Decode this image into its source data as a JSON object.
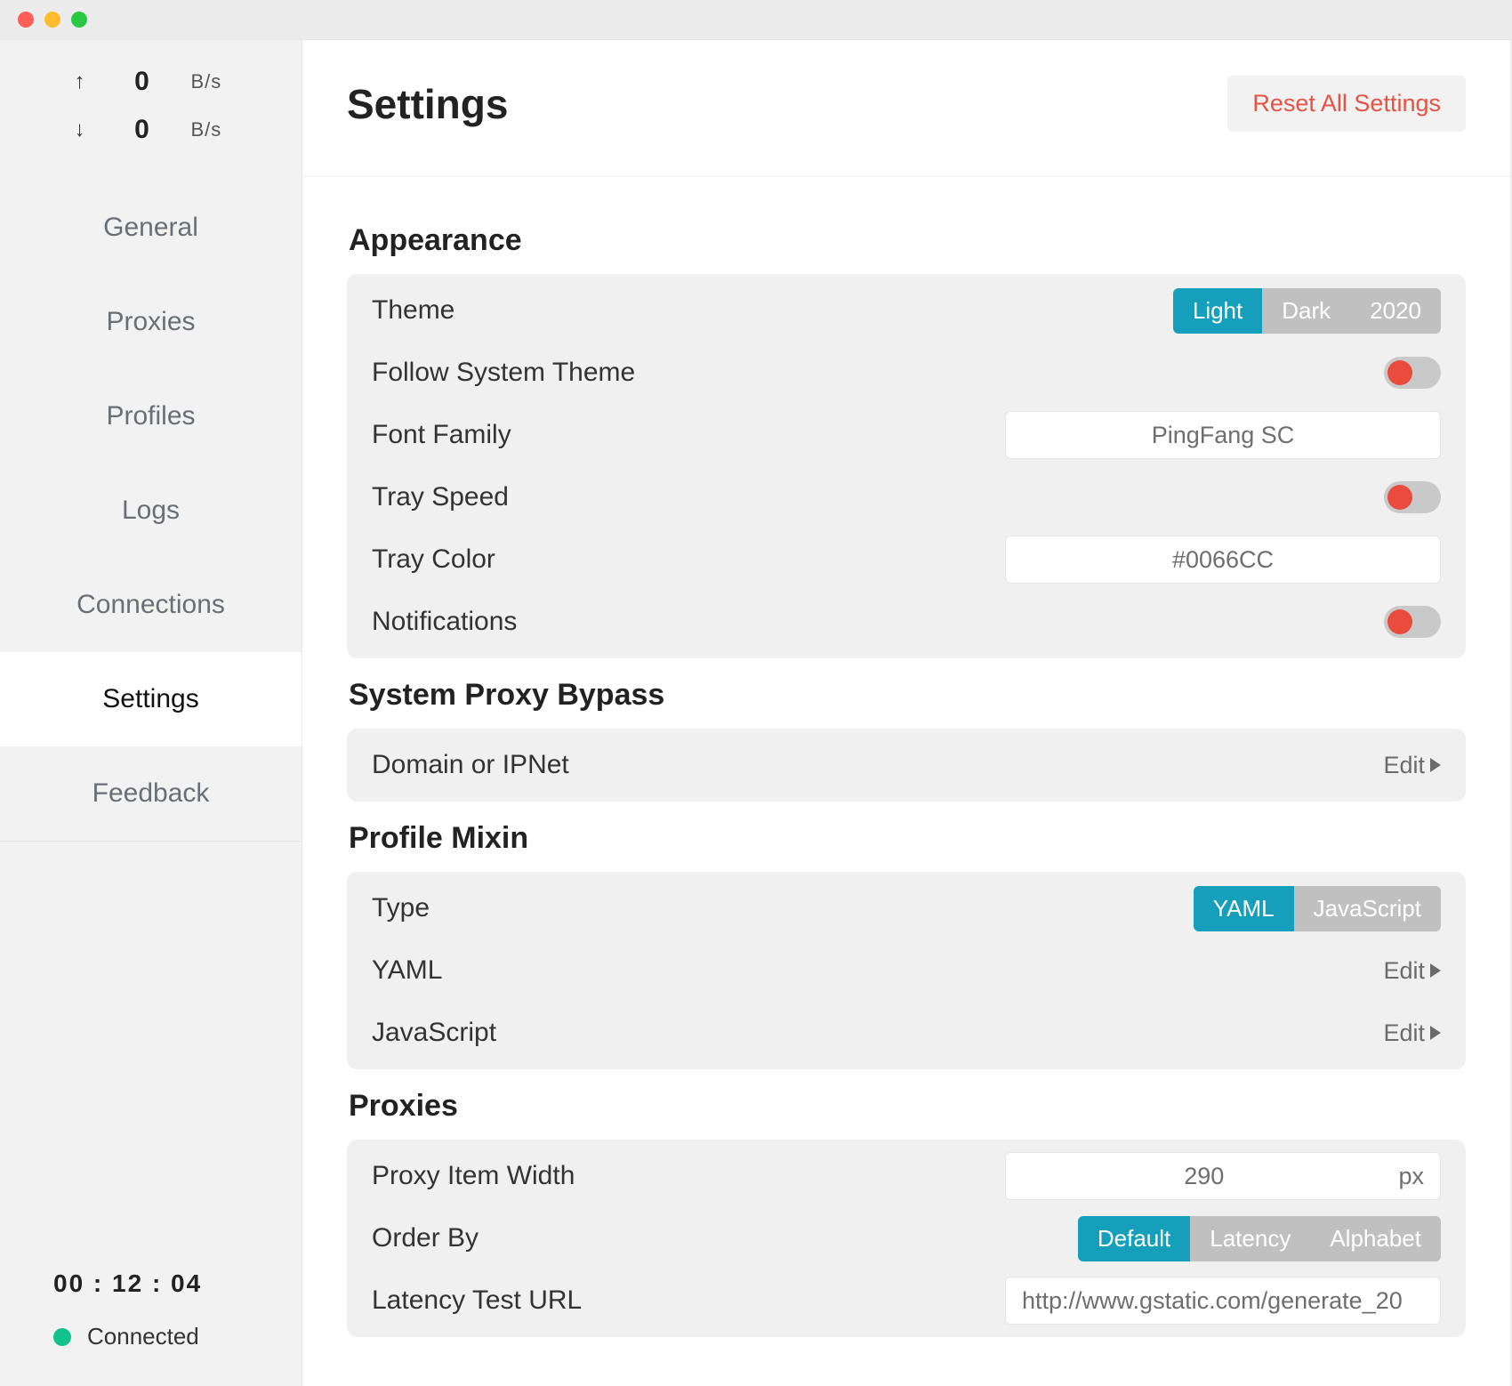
{
  "window": {
    "traffic_lights": [
      "close",
      "minimize",
      "maximize"
    ]
  },
  "sidebar": {
    "speed": {
      "up": {
        "icon": "arrow-up",
        "value": "0",
        "unit": "B/s"
      },
      "down": {
        "icon": "arrow-down",
        "value": "0",
        "unit": "B/s"
      }
    },
    "nav": [
      {
        "id": "general",
        "label": "General"
      },
      {
        "id": "proxies",
        "label": "Proxies"
      },
      {
        "id": "profiles",
        "label": "Profiles"
      },
      {
        "id": "logs",
        "label": "Logs"
      },
      {
        "id": "connections",
        "label": "Connections"
      },
      {
        "id": "settings",
        "label": "Settings",
        "active": true
      },
      {
        "id": "feedback",
        "label": "Feedback"
      }
    ],
    "uptime": "00 : 12 : 04",
    "status": {
      "text": "Connected",
      "color": "#11c28c"
    }
  },
  "header": {
    "title": "Settings",
    "reset_label": "Reset All Settings"
  },
  "sections": {
    "appearance": {
      "title": "Appearance",
      "theme": {
        "label": "Theme",
        "options": [
          "Light",
          "Dark",
          "2020"
        ],
        "selected": "Light"
      },
      "follow_system": {
        "label": "Follow System Theme",
        "value": false
      },
      "font_family": {
        "label": "Font Family",
        "value": "PingFang SC"
      },
      "tray_speed": {
        "label": "Tray Speed",
        "value": false
      },
      "tray_color": {
        "label": "Tray Color",
        "value": "#0066CC"
      },
      "notifications": {
        "label": "Notifications",
        "value": false
      }
    },
    "system_proxy_bypass": {
      "title": "System Proxy Bypass",
      "domain_ipnet": {
        "label": "Domain or IPNet",
        "action": "Edit"
      }
    },
    "profile_mixin": {
      "title": "Profile Mixin",
      "type": {
        "label": "Type",
        "options": [
          "YAML",
          "JavaScript"
        ],
        "selected": "YAML"
      },
      "yaml": {
        "label": "YAML",
        "action": "Edit"
      },
      "js": {
        "label": "JavaScript",
        "action": "Edit"
      }
    },
    "proxies": {
      "title": "Proxies",
      "proxy_item_width": {
        "label": "Proxy Item Width",
        "value": "290",
        "unit": "px"
      },
      "order_by": {
        "label": "Order By",
        "options": [
          "Default",
          "Latency",
          "Alphabet"
        ],
        "selected": "Default"
      },
      "latency_test_url": {
        "label": "Latency Test URL",
        "value": "http://www.gstatic.com/generate_20"
      }
    }
  },
  "strings": {
    "edit": "Edit"
  }
}
